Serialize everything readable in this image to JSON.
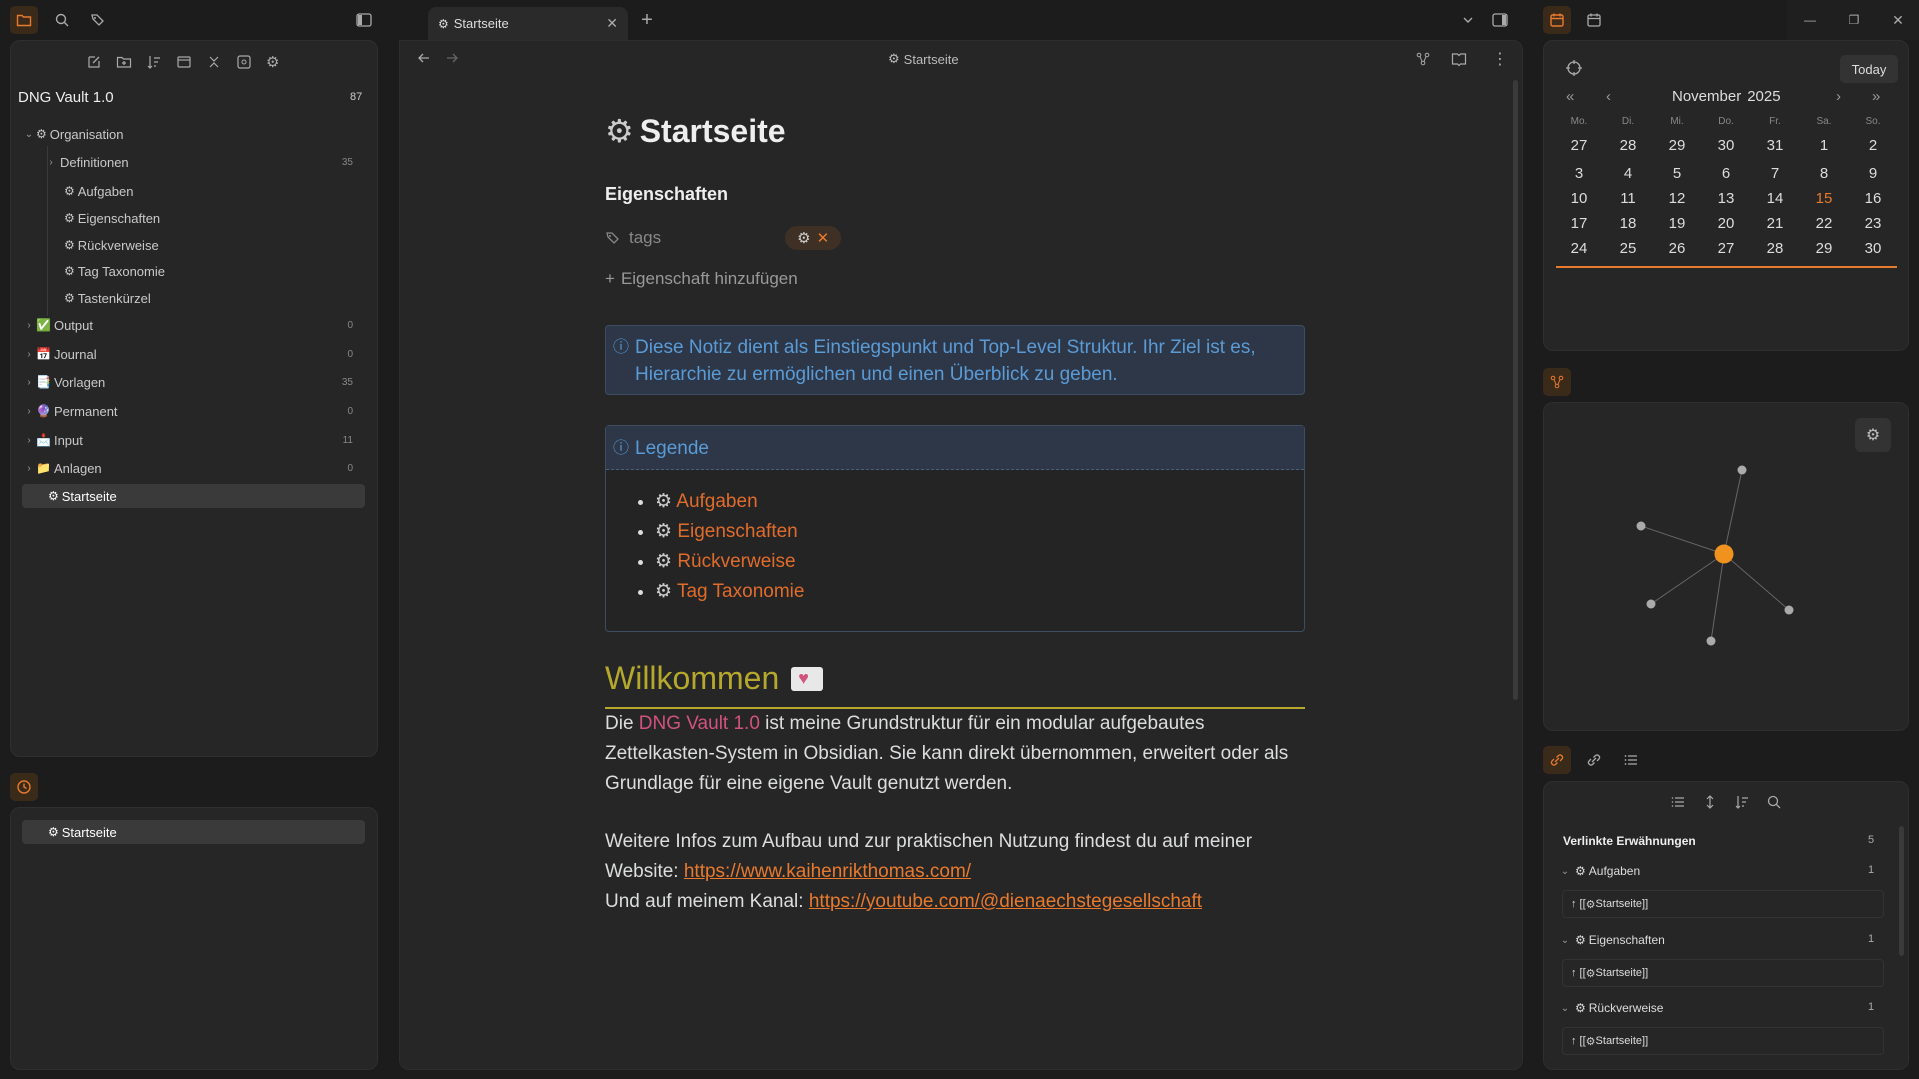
{
  "tab": {
    "title": "Startseite"
  },
  "vault": {
    "name": "DNG Vault 1.0",
    "count": "87"
  },
  "explorer": {
    "items": [
      {
        "label": "Organisation",
        "emoji": "⚙️",
        "count": ""
      },
      {
        "label": "Definitionen",
        "emoji": "",
        "count": "35"
      },
      {
        "label": "Aufgaben",
        "emoji": "⚙️",
        "count": ""
      },
      {
        "label": "Eigenschaften",
        "emoji": "⚙️",
        "count": ""
      },
      {
        "label": "Rückverweise",
        "emoji": "⚙️",
        "count": ""
      },
      {
        "label": "Tag Taxonomie",
        "emoji": "⚙️",
        "count": ""
      },
      {
        "label": "Tastenkürzel",
        "emoji": "⚙️",
        "count": ""
      },
      {
        "label": "Output",
        "emoji": "✅",
        "count": "0"
      },
      {
        "label": "Journal",
        "emoji": "📅",
        "count": "0"
      },
      {
        "label": "Vorlagen",
        "emoji": "📑",
        "count": "35"
      },
      {
        "label": "Permanent",
        "emoji": "🔮",
        "count": "0"
      },
      {
        "label": "Input",
        "emoji": "📩",
        "count": "11"
      },
      {
        "label": "Anlagen",
        "emoji": "📁",
        "count": "0"
      },
      {
        "label": "Startseite",
        "emoji": "⚙️",
        "count": ""
      }
    ]
  },
  "recent": {
    "item": "Startseite"
  },
  "editor": {
    "header_title": "Startseite",
    "title": "Startseite",
    "properties_heading": "Eigenschaften",
    "prop_tags_label": "tags",
    "add_property": "Eigenschaft hinzufügen",
    "info_callout": "Diese Notiz dient als Einstiegspunkt und Top-Level Struktur. Ihr Ziel ist es, Hierarchie zu ermöglichen und einen Überblick zu geben.",
    "legend_title": "Legende",
    "legend_items": [
      "Aufgaben",
      "Eigenschaften",
      "Rückverweise",
      "Tag Taxonomie"
    ],
    "welcome_heading": "Willkommen",
    "welcome_p1_pre": "Die ",
    "welcome_p1_vault": "DNG Vault 1.0",
    "welcome_p1_post": " ist meine Grundstruktur für ein modular aufgebautes Zettelkasten-System in Obsidian. Sie kann direkt übernommen, erweitert oder als Grundlage für eine eigene Vault genutzt werden.",
    "welcome_p2": "Weitere Infos zum Aufbau und zur praktischen Nutzung findest du auf meiner Website: ",
    "website_link": "https://www.kaihenrikthomas.com/",
    "channel_pre": "Und auf meinem Kanal: ",
    "channel_link": "https://youtube.com/@dienaechstegesellschaft"
  },
  "calendar": {
    "today_button": "Today",
    "month": "November",
    "year": "2025",
    "weekdays": [
      "Mo.",
      "Di.",
      "Mi.",
      "Do.",
      "Fr.",
      "Sa.",
      "So."
    ],
    "weeks": [
      [
        "27",
        "28",
        "29",
        "30",
        "31",
        "1",
        "2"
      ],
      [
        "3",
        "4",
        "5",
        "6",
        "7",
        "8",
        "9"
      ],
      [
        "10",
        "11",
        "12",
        "13",
        "14",
        "15",
        "16"
      ],
      [
        "17",
        "18",
        "19",
        "20",
        "21",
        "22",
        "23"
      ],
      [
        "24",
        "25",
        "26",
        "27",
        "28",
        "29",
        "30"
      ]
    ],
    "today": "15",
    "accent_color": "#e87a2e"
  },
  "backlinks": {
    "heading": "Verlinkte Erwähnungen",
    "count": "5",
    "groups": [
      {
        "label": "Aufgaben",
        "count": "1",
        "ref": "Startseite"
      },
      {
        "label": "Eigenschaften",
        "count": "1",
        "ref": "Startseite"
      },
      {
        "label": "Rückverweise",
        "count": "1",
        "ref": "Startseite"
      }
    ]
  }
}
